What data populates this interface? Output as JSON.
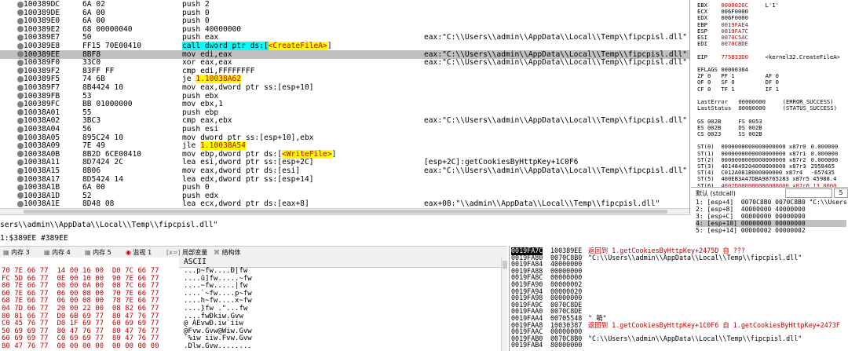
{
  "disasm": {
    "rows": [
      {
        "addr": "100389DC",
        "bytes": "6A 02",
        "ins": "push 2",
        "cmt": ""
      },
      {
        "addr": "100389DE",
        "bytes": "6A 00",
        "ins": "push 0",
        "cmt": ""
      },
      {
        "addr": "100389E0",
        "bytes": "6A 00",
        "ins": "push 0",
        "cmt": ""
      },
      {
        "addr": "100389E2",
        "bytes": "68 00000040",
        "ins": "push 40000000",
        "cmt": ""
      },
      {
        "addr": "100389E7",
        "bytes": "50",
        "ins": "push eax",
        "cmt": "eax:\"C:\\\\Users\\\\admin\\\\AppData\\\\Local\\\\Temp\\\\fipcpisl.dll\""
      },
      {
        "addr": "100389E8",
        "bytes": "FF15 70E00410",
        "ins": "call dword ptr ds:[<CreateFileA>]",
        "cmt": ""
      },
      {
        "addr": "100389EE",
        "bytes": "8BF8",
        "ins": "mov edi,eax",
        "cmt": "eax:\"C:\\\\Users\\\\admin\\\\AppData\\\\Local\\\\Temp\\\\fipcpisl.dll\""
      },
      {
        "addr": "100389F0",
        "bytes": "33C0",
        "ins": "xor eax,eax",
        "cmt": "eax:\"C:\\\\Users\\\\admin\\\\AppData\\\\Local\\\\Temp\\\\fipcpisl.dll\""
      },
      {
        "addr": "100389F2",
        "bytes": "83FF FF",
        "ins": "cmp edi,FFFFFFFF",
        "cmt": ""
      },
      {
        "addr": "100389F5",
        "bytes": "74 6B",
        "ins": "je 1.10038A62",
        "cmt": ""
      },
      {
        "addr": "100389F7",
        "bytes": "8B4424 10",
        "ins": "mov eax,dword ptr ss:[esp+10]",
        "cmt": ""
      },
      {
        "addr": "100389FB",
        "bytes": "53",
        "ins": "push ebx",
        "cmt": ""
      },
      {
        "addr": "100389FC",
        "bytes": "BB 01000000",
        "ins": "mov ebx,1",
        "cmt": ""
      },
      {
        "addr": "10038A01",
        "bytes": "55",
        "ins": "push ebp",
        "cmt": ""
      },
      {
        "addr": "10038A02",
        "bytes": "3BC3",
        "ins": "cmp eax,ebx",
        "cmt": "eax:\"C:\\\\Users\\\\admin\\\\AppData\\\\Local\\\\Temp\\\\fipcpisl.dll\""
      },
      {
        "addr": "10038A04",
        "bytes": "56",
        "ins": "push esi",
        "cmt": ""
      },
      {
        "addr": "10038A05",
        "bytes": "895C24 10",
        "ins": "mov dword ptr ss:[esp+10],ebx",
        "cmt": ""
      },
      {
        "addr": "10038A09",
        "bytes": "7E 49",
        "ins": "jle 1.10038A54",
        "cmt": ""
      },
      {
        "addr": "10038A0B",
        "bytes": "8B2D 6CE00410",
        "ins": "mov ebp,dword ptr ds:[<WriteFile>]",
        "cmt": ""
      },
      {
        "addr": "10038A11",
        "bytes": "8D7424 2C",
        "ins": "lea esi,dword ptr ss:[esp+2C]",
        "cmt": "[esp+2C]:getCookiesByHttpKey+1C0F6"
      },
      {
        "addr": "10038A15",
        "bytes": "8B06",
        "ins": "mov eax,dword ptr ds:[esi]",
        "cmt": "eax:\"C:\\\\Users\\\\admin\\\\AppData\\\\Local\\\\Temp\\\\fipcpisl.dll\""
      },
      {
        "addr": "10038A17",
        "bytes": "8D5424 14",
        "ins": "lea edx,dword ptr ss:[esp+14]",
        "cmt": ""
      },
      {
        "addr": "10038A1B",
        "bytes": "6A 00",
        "ins": "push 0",
        "cmt": ""
      },
      {
        "addr": "10038A1D",
        "bytes": "52",
        "ins": "push edx",
        "cmt": ""
      },
      {
        "addr": "10038A1E",
        "bytes": "8D48 08",
        "ins": "lea ecx,dword ptr ds:[eax+8]",
        "cmt": "eax+08:\"\\\\admin\\\\AppData\\\\Local\\\\Temp\\\\fipcpisl.dll\""
      },
      {
        "addr": "10038A21",
        "bytes": "8B40 04",
        "ins": "mov eax,dword ptr ds:[eax+4]",
        "cmt": "eax:\"C:\\\\Users\\\\admin\\\\AppData\\\\Local\\\\Temp\\\\fipcpisl.dll\""
      },
      {
        "addr": "10038A24",
        "bytes": "50",
        "ins": "push eax",
        "cmt": "eax:\"C:\\\\Users\\\\admin\\\\AppData\\\\Local\\\\Temp\\\\fipcpisl.dll\""
      }
    ],
    "eip_label": "EIP",
    "selected_index": 6,
    "call_parts": {
      "pre": "call dword ptr ds:[",
      "target": "<CreateFileA>",
      "post": "]"
    },
    "je_parts": {
      "op": "je ",
      "target": "1.10038A62"
    },
    "jle_parts": {
      "op": "jle ",
      "target": "1.10038A54"
    },
    "wf_parts": {
      "pre": "mov ebp,dword ptr ds:[",
      "target": "<WriteFile>",
      "post": "]"
    }
  },
  "registers": {
    "lines": [
      {
        "k": "EBX",
        "v": "0000026C",
        "c": "L'1'"
      },
      {
        "k": "ECX",
        "v": "006F0000",
        "c": ""
      },
      {
        "k": "EDX",
        "v": "006F0000",
        "c": ""
      },
      {
        "k": "EBP",
        "v": "0019FAE4",
        "c": ""
      },
      {
        "k": "ESP",
        "v": "0019FA7C",
        "c": ""
      },
      {
        "k": "ESI",
        "v": "0070C5AC",
        "c": ""
      },
      {
        "k": "EDI",
        "v": "0070CBDE",
        "c": ""
      },
      {
        "k": "",
        "v": "",
        "c": ""
      },
      {
        "k": "EIP",
        "v": "775833D0",
        "c": "<kernel32.CreateFileA>"
      },
      {
        "k": "",
        "v": "",
        "c": ""
      },
      {
        "k": "EFLAGS",
        "v": "00000304",
        "c": ""
      },
      {
        "k": "ZF 0",
        "v": "PF 1",
        "c": "AF 0"
      },
      {
        "k": "OF 0",
        "v": "SF 0",
        "c": "DF 0"
      },
      {
        "k": "CF 0",
        "v": "TF 1",
        "c": "IF 1"
      },
      {
        "k": "",
        "v": "",
        "c": ""
      },
      {
        "k": "LastError",
        "v": "00000000",
        "c": "(ERROR_SUCCESS)"
      },
      {
        "k": "LastStatus",
        "v": "00000000",
        "c": "(STATUS_SUCCESS)"
      },
      {
        "k": "",
        "v": "",
        "c": ""
      },
      {
        "k": "GS 002B",
        "v": "FS 0053",
        "c": ""
      },
      {
        "k": "ES 002B",
        "v": "DS 002B",
        "c": ""
      },
      {
        "k": "CS 0023",
        "v": "SS 002B",
        "c": ""
      },
      {
        "k": "",
        "v": "",
        "c": ""
      },
      {
        "k": "ST(0)",
        "v": "0000000000000000000 x87r0",
        "c": "0.000000"
      },
      {
        "k": "ST(1)",
        "v": "0000000000000000000 x87r1",
        "c": "0.000000"
      },
      {
        "k": "ST(2)",
        "v": "0000000000000000000 x87r2",
        "c": "0.000000"
      },
      {
        "k": "ST(3)",
        "v": "4014849204000000000 x87r3",
        "c": "2958465"
      },
      {
        "k": "ST(4)",
        "v": "C012A081B000000000 x87r4",
        "c": "-657435"
      },
      {
        "k": "ST(5)",
        "v": "400EB3A47DBA98765283 x87r5",
        "c": "45988.4"
      },
      {
        "k": "ST(6)",
        "v": "4002D000000000000000 x87r6",
        "c": "13.0000"
      }
    ]
  },
  "args": {
    "header": "默认 (stdcall)",
    "count": "5",
    "lines": [
      "1: [esp+4]  0070C8B0 0070C8B0 \"C:\\\\Users",
      "2: [esp+8]  40000000 40000000",
      "3: [esp+C]  00000000 00000000",
      "4: [esp+10] 00000000 00000000",
      "5: [esp+14] 00000002 00000002"
    ]
  },
  "info": {
    "line1": "sers\\\\admin\\\\AppData\\\\Local\\\\Temp\\\\fipcpisl.dll\"",
    "line2": "1:$389EE #389EE"
  },
  "tabs": [
    "内存 3",
    "内存 4",
    "内存 5",
    "监视 1",
    "局部变量",
    "结构体"
  ],
  "dump": {
    "ascii_header": "ASCII",
    "rows": [
      {
        "hex": "70 7E 66 77  14 00 16 00  D0 7C 66 77",
        "ascii": "...p~fw....Ð|fw"
      },
      {
        "hex": "FC 5D 66 77  0E 00 10 00  90 7E 66 77",
        "ascii": "....ü]fw.....~fw"
      },
      {
        "hex": "80 7E 66 77  00 00 0A 00  08 7C 66 77",
        "ascii": "....~fw.....|fw"
      },
      {
        "hex": "60 7E 66 77  06 00 08 00  70 7E 66 77",
        "ascii": "....`~fw....p~fw"
      },
      {
        "hex": "68 7E 66 77  06 00 08 00  78 7E 66 77",
        "ascii": "....h~fw....x~fw"
      },
      {
        "hex": "04 7D 66 77  20 00 22 00  08 82 66 77",
        "ascii": "....}fw .\"...fw"
      },
      {
        "hex": "80 81 66 77  D0 6B 69 77  80 47 76 77",
        "ascii": "....fwÐkiw.Gvw"
      },
      {
        "hex": "C0 45 76 77  D0 1F 69 77  60 69 69 77",
        "ascii": "@ ÀEvwÐ.iw`iiw"
      },
      {
        "hex": "50 69 69 77  80 47 76 77  80 47 76 77",
        "ascii": "@Fvw.Gvw@Wiw.Gvw"
      },
      {
        "hex": "60 69 69 77  C0 69 69 77  80 47 76 77",
        "ascii": "`%iw iiw.Fvw.Gvw"
      },
      {
        "hex": "80 47 76 77  00 00 00 00  00 00 00 00",
        "ascii": ".Dlw.Gvw........"
      }
    ]
  },
  "stack": {
    "rows": [
      {
        "a": "0019FA7C",
        "v": "100389EE",
        "c": "返回到 1.getCookiesByHttpKey+2475D 自 ???"
      },
      {
        "a": "0019FA80",
        "v": "0070C8B0",
        "c": "\"C:\\\\Users\\\\admin\\\\AppData\\\\Local\\\\Temp\\\\fipcpisl.dll\""
      },
      {
        "a": "0019FA84",
        "v": "40000000",
        "c": ""
      },
      {
        "a": "0019FA88",
        "v": "00000000",
        "c": ""
      },
      {
        "a": "0019FA8C",
        "v": "00000000",
        "c": ""
      },
      {
        "a": "0019FA90",
        "v": "00000002",
        "c": ""
      },
      {
        "a": "0019FA94",
        "v": "00000020",
        "c": ""
      },
      {
        "a": "0019FA98",
        "v": "00000000",
        "c": ""
      },
      {
        "a": "0019FA9C",
        "v": "0070C8DE",
        "c": ""
      },
      {
        "a": "0019FAA0",
        "v": "0070C8DE",
        "c": ""
      },
      {
        "a": "0019FAA4",
        "v": "00705548",
        "c": "\" 萌\""
      },
      {
        "a": "0019FAA8",
        "v": "10030387",
        "c": "返回到 1.getCookiesByHttpKey+1C0F6 自 1.getCookiesByHttpKey+2473F"
      },
      {
        "a": "0019FAAC",
        "v": "00000000",
        "c": ""
      },
      {
        "a": "0019FAB0",
        "v": "0070C8B0",
        "c": "\"C:\\\\Users\\\\admin\\\\AppData\\\\Local\\\\Temp\\\\fipcpisl.dll\""
      },
      {
        "a": "0019FAB4",
        "v": "80000000",
        "c": ""
      }
    ]
  },
  "colors": {
    "selected_row": "#c0c0c0",
    "highlight_yellow": "#ffff00",
    "highlight_cyan": "#00ffff",
    "return_red": "#c00000"
  }
}
